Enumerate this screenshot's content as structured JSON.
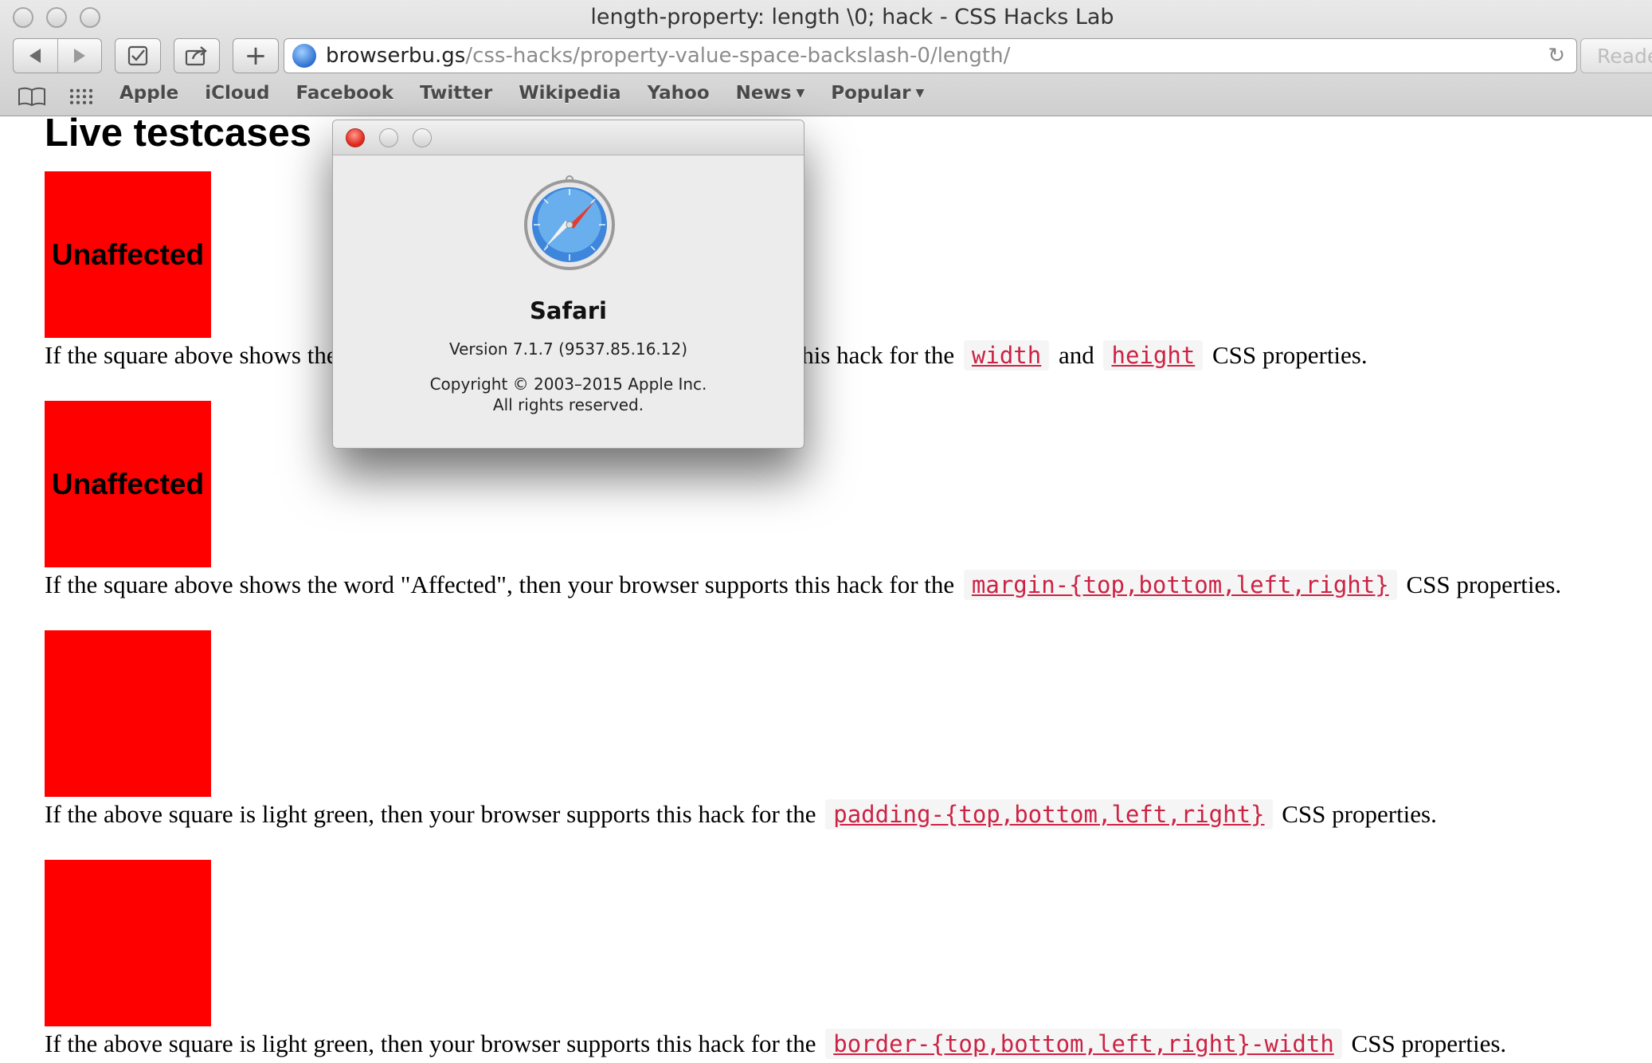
{
  "window": {
    "title": "length-property: length \\0; hack - CSS Hacks Lab"
  },
  "toolbar": {
    "url_host": "browserbu.gs",
    "url_path": "/css-hacks/property-value-space-backslash-0/length/",
    "reader_label": "Reader",
    "plus_label": "+"
  },
  "bookmarks": {
    "items": [
      {
        "label": "Apple",
        "dropdown": false
      },
      {
        "label": "iCloud",
        "dropdown": false
      },
      {
        "label": "Facebook",
        "dropdown": false
      },
      {
        "label": "Twitter",
        "dropdown": false
      },
      {
        "label": "Wikipedia",
        "dropdown": false
      },
      {
        "label": "Yahoo",
        "dropdown": false
      },
      {
        "label": "News",
        "dropdown": true
      },
      {
        "label": "Popular",
        "dropdown": true
      }
    ]
  },
  "page": {
    "heading": "Live testcases",
    "testcases": [
      {
        "square_label": "Unaffected",
        "color": "#ff0000",
        "text_before": "If the square above shows the word \"Affected\", then your browser supports this hack for the",
        "codes": [
          "width",
          "height"
        ],
        "joiner": "and",
        "text_after": "CSS properties."
      },
      {
        "square_label": "Unaffected",
        "color": "#ff0000",
        "text_before": "If the square above shows the word \"Affected\", then your browser supports this hack for the",
        "codes": [
          "margin-{top,bottom,left,right}"
        ],
        "text_after": "CSS properties."
      },
      {
        "square_label": "",
        "color": "#ff0000",
        "text_before": "If the above square is light green, then your browser supports this hack for the",
        "codes": [
          "padding-{top,bottom,left,right}"
        ],
        "text_after": "CSS properties."
      },
      {
        "square_label": "",
        "color": "#ff0000",
        "text_before": "If the above square is light green, then your browser supports this hack for the",
        "codes": [
          "border-{top,bottom,left,right}-width"
        ],
        "text_after": "CSS properties."
      }
    ]
  },
  "about_dialog": {
    "app_name": "Safari",
    "version": "Version 7.1.7 (9537.85.16.12)",
    "copyright_line1": "Copyright © 2003–2015 Apple Inc.",
    "copyright_line2": "All rights reserved.",
    "icon": "safari-compass-icon"
  }
}
